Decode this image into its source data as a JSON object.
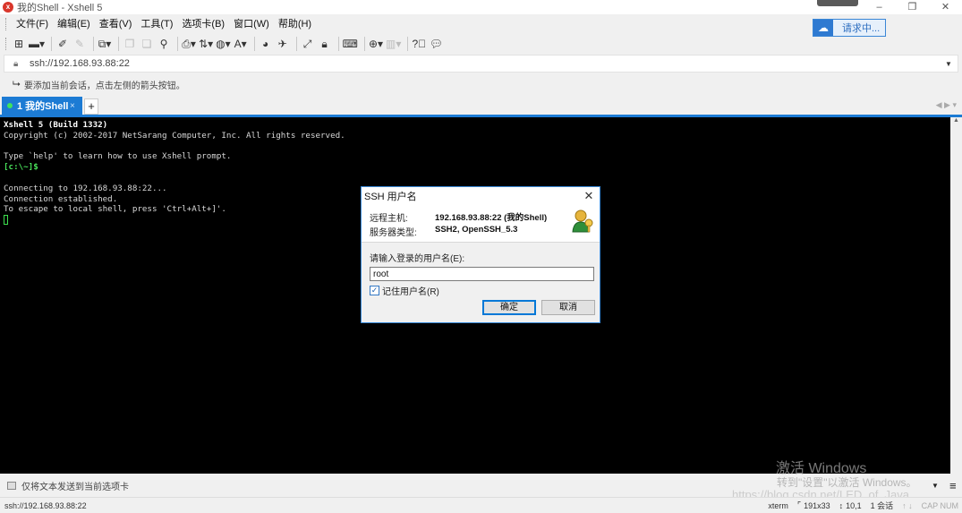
{
  "window": {
    "title": "我的Shell - Xshell 5",
    "minimize": "–",
    "restore": "❐",
    "close": "✕"
  },
  "menu": [
    "文件(F)",
    "编辑(E)",
    "查看(V)",
    "工具(T)",
    "选项卡(B)",
    "窗口(W)",
    "帮助(H)"
  ],
  "request_button": {
    "label": "请求中..."
  },
  "address": {
    "value": "ssh://192.168.93.88:22"
  },
  "hint": {
    "text": "要添加当前会话，点击左侧的箭头按钮。"
  },
  "tab": {
    "label": "1 我的Shell",
    "close": "×",
    "add": "+"
  },
  "terminal": {
    "lines": [
      "Xshell 5 (Build 1332)",
      "Copyright (c) 2002-2017 NetSarang Computer, Inc. All rights reserved.",
      "",
      "Type `help' to learn how to use Xshell prompt.",
      "[c:\\~]$",
      "",
      "Connecting to 192.168.93.88:22...",
      "Connection established.",
      "To escape to local shell, press 'Ctrl+Alt+]'."
    ]
  },
  "dialog": {
    "title": "SSH 用户名",
    "remote_host_label": "远程主机:",
    "remote_host_value": "192.168.93.88:22 (我的Shell)",
    "server_type_label": "服务器类型:",
    "server_type_value": "SSH2, OpenSSH_5.3",
    "prompt": "请输入登录的用户名(E):",
    "username": "root",
    "remember_label": "记住用户名(R)",
    "remember_checked": true,
    "ok": "确定",
    "cancel": "取消"
  },
  "watermark": {
    "line1": "激活 Windows",
    "line2": "转到\"设置\"以激活 Windows。",
    "line3": "https://blog.csdn.net/LED_of_Java"
  },
  "compose": {
    "text": "仅将文本发送到当前选项卡"
  },
  "status": {
    "address": "ssh://192.168.93.88:22",
    "terminal_type": "xterm",
    "size": "191x33",
    "cursor": "10,1",
    "sessions": "1 会话",
    "caps": "CAP NUM"
  },
  "colors": {
    "accent": "#1c7bd4",
    "terminal_bg": "#000000",
    "terminal_green": "#48e05a"
  }
}
